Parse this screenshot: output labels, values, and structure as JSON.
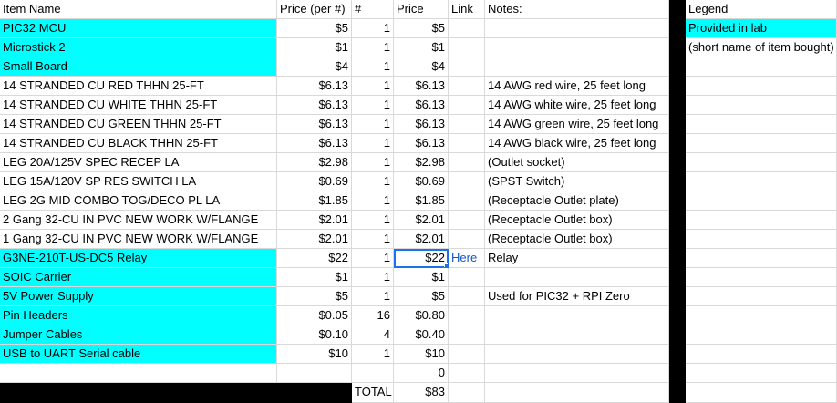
{
  "header": {
    "item_name": "Item Name",
    "price_per": "Price (per #)",
    "qty": "#",
    "price": "Price",
    "link": "Link",
    "notes": "Notes:"
  },
  "legend": {
    "title": "Legend",
    "provided": "Provided in lab",
    "short_name": "(short name of item bought)",
    "provided_color": "#00ffff"
  },
  "rows": [
    {
      "name": "PIC32 MCU",
      "price_per": "$5",
      "qty": "1",
      "price": "$5",
      "link": "",
      "notes": "",
      "provided": true
    },
    {
      "name": "Microstick 2",
      "price_per": "$1",
      "qty": "1",
      "price": "$1",
      "link": "",
      "notes": "",
      "provided": true
    },
    {
      "name": "Small Board",
      "price_per": "$4",
      "qty": "1",
      "price": "$4",
      "link": "",
      "notes": "",
      "provided": true
    },
    {
      "name": "14 STRANDED CU RED THHN 25-FT",
      "price_per": "$6.13",
      "qty": "1",
      "price": "$6.13",
      "link": "",
      "notes": "14 AWG red wire, 25 feet long",
      "provided": false
    },
    {
      "name": "14 STRANDED CU WHITE THHN 25-FT",
      "price_per": "$6.13",
      "qty": "1",
      "price": "$6.13",
      "link": "",
      "notes": "14 AWG white wire, 25 feet long",
      "provided": false
    },
    {
      "name": "14 STRANDED CU GREEN THHN 25-FT",
      "price_per": "$6.13",
      "qty": "1",
      "price": "$6.13",
      "link": "",
      "notes": "14 AWG green wire, 25 feet long",
      "provided": false
    },
    {
      "name": "14 STRANDED CU BLACK THHN 25-FT",
      "price_per": "$6.13",
      "qty": "1",
      "price": "$6.13",
      "link": "",
      "notes": "14 AWG black wire, 25 feet long",
      "provided": false
    },
    {
      "name": "LEG 20A/125V SPEC RECEP LA",
      "price_per": "$2.98",
      "qty": "1",
      "price": "$2.98",
      "link": "",
      "notes": "(Outlet socket)",
      "provided": false
    },
    {
      "name": "LEG 15A/120V SP RES SWITCH LA",
      "price_per": "$0.69",
      "qty": "1",
      "price": "$0.69",
      "link": "",
      "notes": "(SPST Switch)",
      "provided": false
    },
    {
      "name": "LEG 2G MID COMBO TOG/DECO PL LA",
      "price_per": "$1.85",
      "qty": "1",
      "price": "$1.85",
      "link": "",
      "notes": "(Receptacle Outlet plate)",
      "provided": false
    },
    {
      "name": "2 Gang 32-CU IN PVC NEW WORK W/FLANGE",
      "price_per": "$2.01",
      "qty": "1",
      "price": "$2.01",
      "link": "",
      "notes": "(Receptacle Outlet box)",
      "provided": false
    },
    {
      "name": "1 Gang 32-CU IN PVC NEW WORK W/FLANGE",
      "price_per": "$2.01",
      "qty": "1",
      "price": "$2.01",
      "link": "",
      "notes": "(Receptacle Outlet box)",
      "provided": false
    },
    {
      "name": "G3NE-210T-US-DC5 Relay",
      "price_per": "$22",
      "qty": "1",
      "price": "$22",
      "link": "Here",
      "notes": "Relay",
      "provided": true
    },
    {
      "name": "SOIC Carrier",
      "price_per": "$1",
      "qty": "1",
      "price": "$1",
      "link": "",
      "notes": "",
      "provided": true
    },
    {
      "name": "5V Power Supply",
      "price_per": "$5",
      "qty": "1",
      "price": "$5",
      "link": "",
      "notes": "Used for PIC32 + RPI Zero",
      "provided": true
    },
    {
      "name": "Pin Headers",
      "price_per": "$0.05",
      "qty": "16",
      "price": "$0.80",
      "link": "",
      "notes": "",
      "provided": true
    },
    {
      "name": "Jumper Cables",
      "price_per": "$0.10",
      "qty": "4",
      "price": "$0.40",
      "link": "",
      "notes": "",
      "provided": true
    },
    {
      "name": "USB to UART Serial cable",
      "price_per": "$10",
      "qty": "1",
      "price": "$10",
      "link": "",
      "notes": "",
      "provided": true
    }
  ],
  "zero_row": {
    "price": "0"
  },
  "total_row": {
    "label": "TOTAL",
    "price": "$83"
  }
}
